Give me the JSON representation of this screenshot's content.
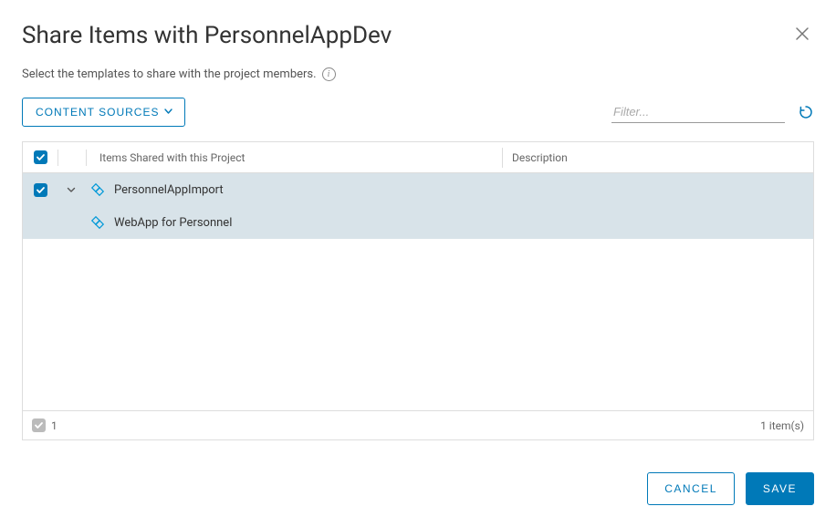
{
  "dialog": {
    "title": "Share Items with PersonnelAppDev",
    "subtitle": "Select the templates to share with the project members."
  },
  "toolbar": {
    "content_sources_label": "CONTENT SOURCES",
    "filter_placeholder": "Filter..."
  },
  "table": {
    "columns": {
      "name": "Items Shared with this Project",
      "description": "Description"
    },
    "rows": [
      {
        "name": "PersonnelAppImport",
        "description": ""
      },
      {
        "name": "WebApp for Personnel",
        "description": ""
      }
    ],
    "footer": {
      "selected_count": "1",
      "total_label": "1 item(s)"
    }
  },
  "actions": {
    "cancel": "CANCEL",
    "save": "SAVE"
  }
}
